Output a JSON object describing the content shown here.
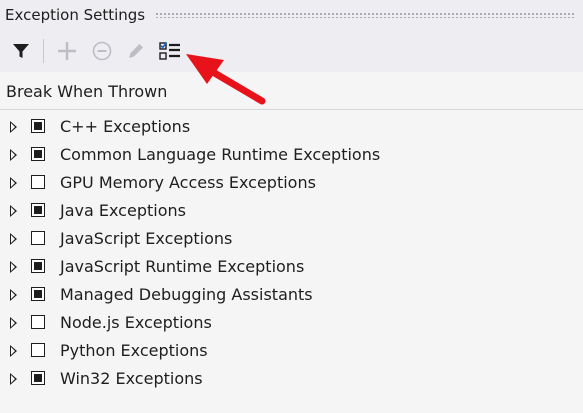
{
  "panel": {
    "title": "Exception Settings"
  },
  "toolbar": {
    "buttons": [
      {
        "name": "filter",
        "icon": "filter-icon",
        "enabled": true
      },
      {
        "name": "add",
        "icon": "plus-icon",
        "enabled": false
      },
      {
        "name": "remove",
        "icon": "minus-circle-icon",
        "enabled": false
      },
      {
        "name": "edit-conditions",
        "icon": "pencil-icon",
        "enabled": false
      },
      {
        "name": "show-only-enabled",
        "icon": "checklist-icon",
        "enabled": true
      }
    ]
  },
  "column_header": {
    "label": "Break When Thrown"
  },
  "categories": [
    {
      "label": "C++ Exceptions",
      "checked": true
    },
    {
      "label": "Common Language Runtime Exceptions",
      "checked": true
    },
    {
      "label": "GPU Memory Access Exceptions",
      "checked": false
    },
    {
      "label": "Java Exceptions",
      "checked": true
    },
    {
      "label": "JavaScript Exceptions",
      "checked": false
    },
    {
      "label": "JavaScript Runtime Exceptions",
      "checked": true
    },
    {
      "label": "Managed Debugging Assistants",
      "checked": true
    },
    {
      "label": "Node.js Exceptions",
      "checked": false
    },
    {
      "label": "Python Exceptions",
      "checked": false
    },
    {
      "label": "Win32 Exceptions",
      "checked": true
    }
  ],
  "colors": {
    "accent": "#1e1e1e",
    "annotation_arrow": "#e8121a",
    "disabled": "#bdbdc4"
  }
}
